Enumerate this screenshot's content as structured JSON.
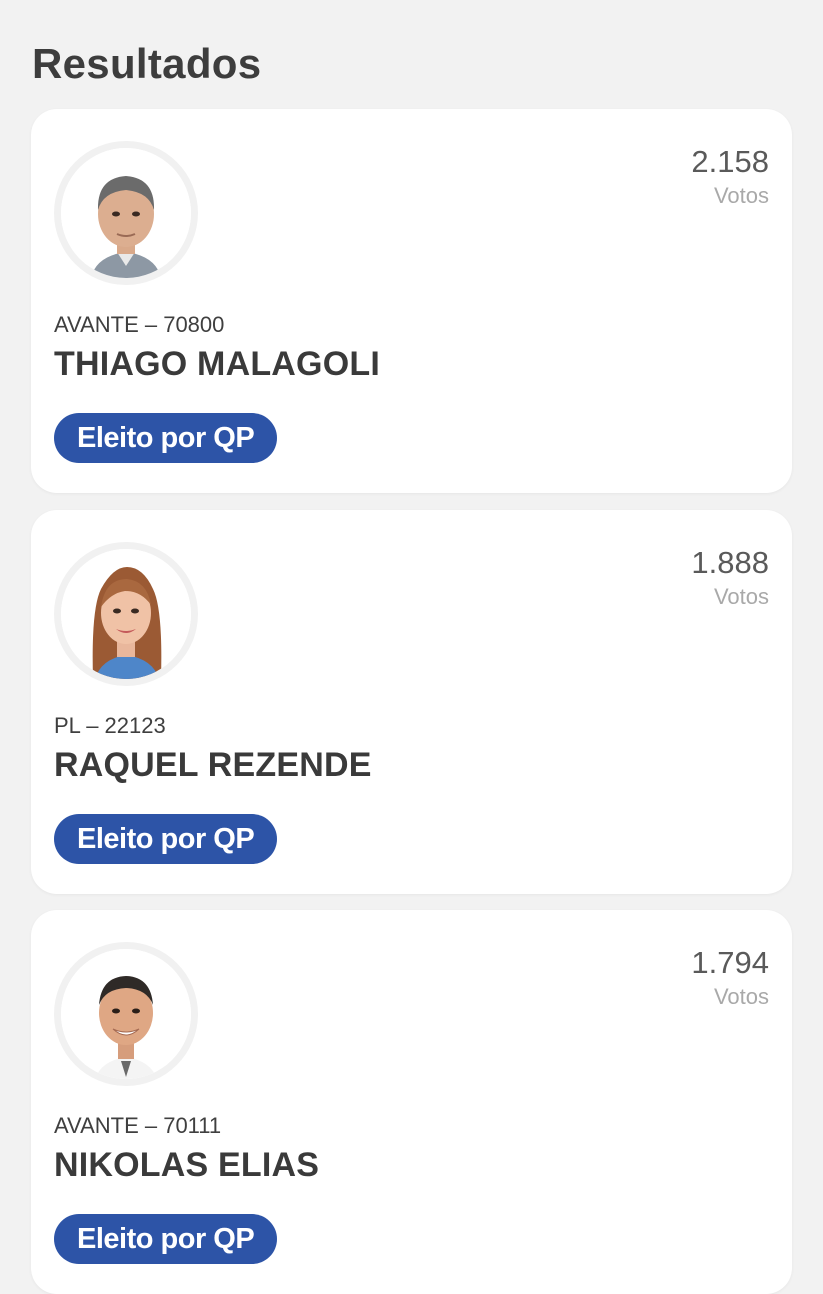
{
  "page": {
    "title": "Resultados"
  },
  "results": [
    {
      "votes": "2.158",
      "votes_label": "Votos",
      "party_number": "AVANTE – 70800",
      "name": "THIAGO MALAGOLI",
      "status": "Eleito por QP"
    },
    {
      "votes": "1.888",
      "votes_label": "Votos",
      "party_number": "PL – 22123",
      "name": "RAQUEL REZENDE",
      "status": "Eleito por QP"
    },
    {
      "votes": "1.794",
      "votes_label": "Votos",
      "party_number": "AVANTE – 70111",
      "name": "NIKOLAS ELIAS",
      "status": "Eleito por QP"
    }
  ],
  "colors": {
    "background": "#f2f2f2",
    "card": "#ffffff",
    "badge": "#2d54a7",
    "badge_text": "#ffffff"
  }
}
